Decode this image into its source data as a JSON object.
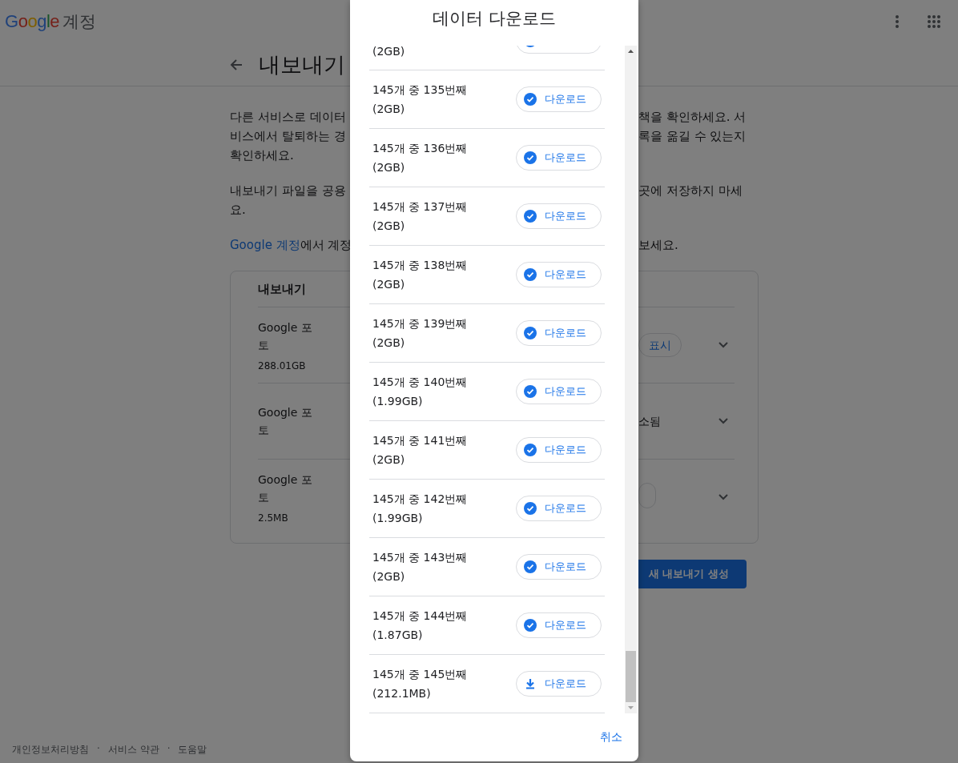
{
  "header": {
    "logo": "Google",
    "product": "계정"
  },
  "page": {
    "title": "내보내기"
  },
  "paragraphs": [
    {
      "left": [
        "다른 서비스로 데이터",
        "비스에서 탈퇴하는 경",
        "확인하세요."
      ],
      "right": [
        "책을 확인하세요. 서",
        "록을 옮길 수 있는지"
      ]
    },
    {
      "left": [
        "내보내기 파일을 공용",
        "요."
      ],
      "right": [
        "곳에 저장하지 마세"
      ]
    },
    {
      "link": "Google 계정",
      "left_rest": "에서 계정",
      "right": [
        "보세요."
      ]
    }
  ],
  "exports_card": {
    "heading": "내보내기",
    "rows": [
      {
        "name": "Google 포\n토",
        "size": "288.01GB",
        "kind": "chip",
        "status": "표시"
      },
      {
        "name": "Google 포\n토",
        "kind": "text",
        "status": "소됨"
      },
      {
        "name": "Google 포\n토",
        "size": "2.5MB",
        "kind": "chip-edge"
      }
    ]
  },
  "create_button": "새 내보내기 생성",
  "footer": [
    "개인정보처리방침",
    "·",
    "서비스 약관",
    "·",
    "도움말"
  ],
  "dialog": {
    "title": "데이터 다운로드",
    "items": [
      {
        "size": "(2GB)",
        "downloaded": true
      },
      {
        "label": "145개 중 135번째",
        "size": "(2GB)",
        "button": "다운로드",
        "downloaded": true
      },
      {
        "label": "145개 중 136번째",
        "size": "(2GB)",
        "button": "다운로드",
        "downloaded": true
      },
      {
        "label": "145개 중 137번째",
        "size": "(2GB)",
        "button": "다운로드",
        "downloaded": true
      },
      {
        "label": "145개 중 138번째",
        "size": "(2GB)",
        "button": "다운로드",
        "downloaded": true
      },
      {
        "label": "145개 중 139번째",
        "size": "(2GB)",
        "button": "다운로드",
        "downloaded": true
      },
      {
        "label": "145개 중 140번째",
        "size": "(1.99GB)",
        "button": "다운로드",
        "downloaded": true
      },
      {
        "label": "145개 중 141번째",
        "size": "(2GB)",
        "button": "다운로드",
        "downloaded": true
      },
      {
        "label": "145개 중 142번째",
        "size": "(1.99GB)",
        "button": "다운로드",
        "downloaded": true
      },
      {
        "label": "145개 중 143번째",
        "size": "(2GB)",
        "button": "다운로드",
        "downloaded": true
      },
      {
        "label": "145개 중 144번째",
        "size": "(1.87GB)",
        "button": "다운로드",
        "downloaded": true
      },
      {
        "label": "145개 중 145번째",
        "size": "(212.1MB)",
        "button": "다운로드",
        "downloaded": false
      }
    ],
    "cancel": "취소"
  }
}
